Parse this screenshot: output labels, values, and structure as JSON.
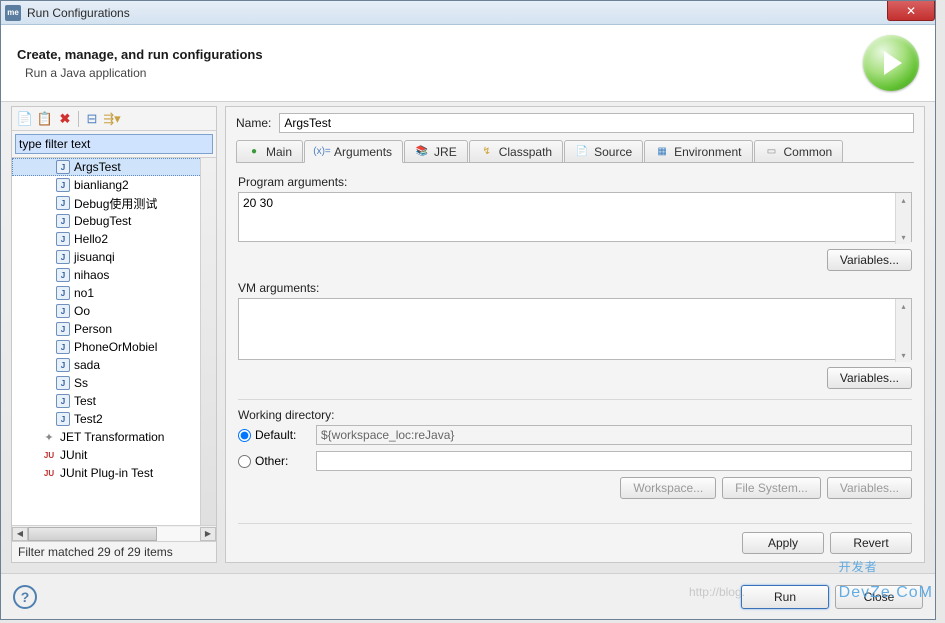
{
  "window": {
    "title": "Run Configurations"
  },
  "header": {
    "heading": "Create, manage, and run configurations",
    "subheading": "Run a Java application"
  },
  "sidebar": {
    "filter_placeholder": "type filter text",
    "filter_value": "type filter text",
    "items": [
      {
        "label": "ArgsTest",
        "icon": "java-launch",
        "selected": true
      },
      {
        "label": "bianliang2",
        "icon": "java-launch"
      },
      {
        "label": "Debug使用测试",
        "icon": "java-launch"
      },
      {
        "label": "DebugTest",
        "icon": "java-launch"
      },
      {
        "label": "Hello2",
        "icon": "java-launch"
      },
      {
        "label": "jisuanqi",
        "icon": "java-launch"
      },
      {
        "label": "nihaos",
        "icon": "java-launch"
      },
      {
        "label": "no1",
        "icon": "java-launch"
      },
      {
        "label": "Oo",
        "icon": "java-launch"
      },
      {
        "label": "Person",
        "icon": "java-launch"
      },
      {
        "label": "PhoneOrMobiel",
        "icon": "java-launch"
      },
      {
        "label": "sada",
        "icon": "java-launch"
      },
      {
        "label": "Ss",
        "icon": "java-launch"
      },
      {
        "label": "Test",
        "icon": "java-launch"
      },
      {
        "label": "Test2",
        "icon": "java-launch"
      },
      {
        "label": "JET Transformation",
        "icon": "jet",
        "cat": true
      },
      {
        "label": "JUnit",
        "icon": "junit",
        "cat": true
      },
      {
        "label": "JUnit Plug-in Test",
        "icon": "junit",
        "cat": true
      }
    ],
    "filter_status": "Filter matched 29 of 29 items"
  },
  "main": {
    "name_label": "Name:",
    "name_value": "ArgsTest",
    "tabs": [
      {
        "label": "Main",
        "icon": "●",
        "icon_color": "#3a9a3a"
      },
      {
        "label": "Arguments",
        "icon": "(x)=",
        "icon_color": "#5080c0",
        "active": true
      },
      {
        "label": "JRE",
        "icon": "📚",
        "icon_color": "#6080a0"
      },
      {
        "label": "Classpath",
        "icon": "↯",
        "icon_color": "#d0a030"
      },
      {
        "label": "Source",
        "icon": "📄",
        "icon_color": "#7090c0"
      },
      {
        "label": "Environment",
        "icon": "▦",
        "icon_color": "#4080c0"
      },
      {
        "label": "Common",
        "icon": "▭",
        "icon_color": "#888"
      }
    ],
    "program_args_label": "Program arguments:",
    "program_args_value": "20 30",
    "vm_args_label": "VM arguments:",
    "vm_args_value": "",
    "variables_btn": "Variables...",
    "wd_label": "Working directory:",
    "wd_default_label": "Default:",
    "wd_default_value": "${workspace_loc:reJava}",
    "wd_other_label": "Other:",
    "wd_workspace_btn": "Workspace...",
    "wd_filesystem_btn": "File System...",
    "wd_variables_btn": "Variables...",
    "apply_btn": "Apply",
    "revert_btn": "Revert"
  },
  "footer": {
    "run_btn": "Run",
    "close_btn": "Close"
  },
  "watermark": {
    "text": "开发者",
    "sub": "DevZe.CoM",
    "url": "http://blog."
  }
}
